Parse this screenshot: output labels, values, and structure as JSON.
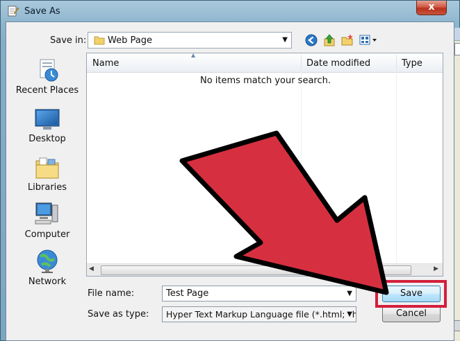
{
  "window": {
    "title": "Save As",
    "close_glyph": "x"
  },
  "toolbar": {
    "save_in_label": "Save in:",
    "save_in_value": "Web Page",
    "icons": [
      "back-icon",
      "up-folder-icon",
      "new-folder-icon",
      "view-menu-icon"
    ]
  },
  "places": [
    {
      "label": "Recent Places",
      "icon": "recent-places-icon"
    },
    {
      "label": "Desktop",
      "icon": "desktop-icon"
    },
    {
      "label": "Libraries",
      "icon": "libraries-icon"
    },
    {
      "label": "Computer",
      "icon": "computer-icon"
    },
    {
      "label": "Network",
      "icon": "network-icon"
    }
  ],
  "list": {
    "columns": [
      "Name",
      "Date modified",
      "Type"
    ],
    "empty_message": "No items match your search."
  },
  "form": {
    "file_name_label": "File name:",
    "file_name_value": "Test Page",
    "save_as_type_label": "Save as type:",
    "save_as_type_value": "Hyper Text Markup Language file (*.html;*.htm;*"
  },
  "buttons": {
    "save": "Save",
    "cancel": "Cancel"
  },
  "colors": {
    "annotation_red": "#d63040",
    "highlight_border": "#d31f3b"
  }
}
